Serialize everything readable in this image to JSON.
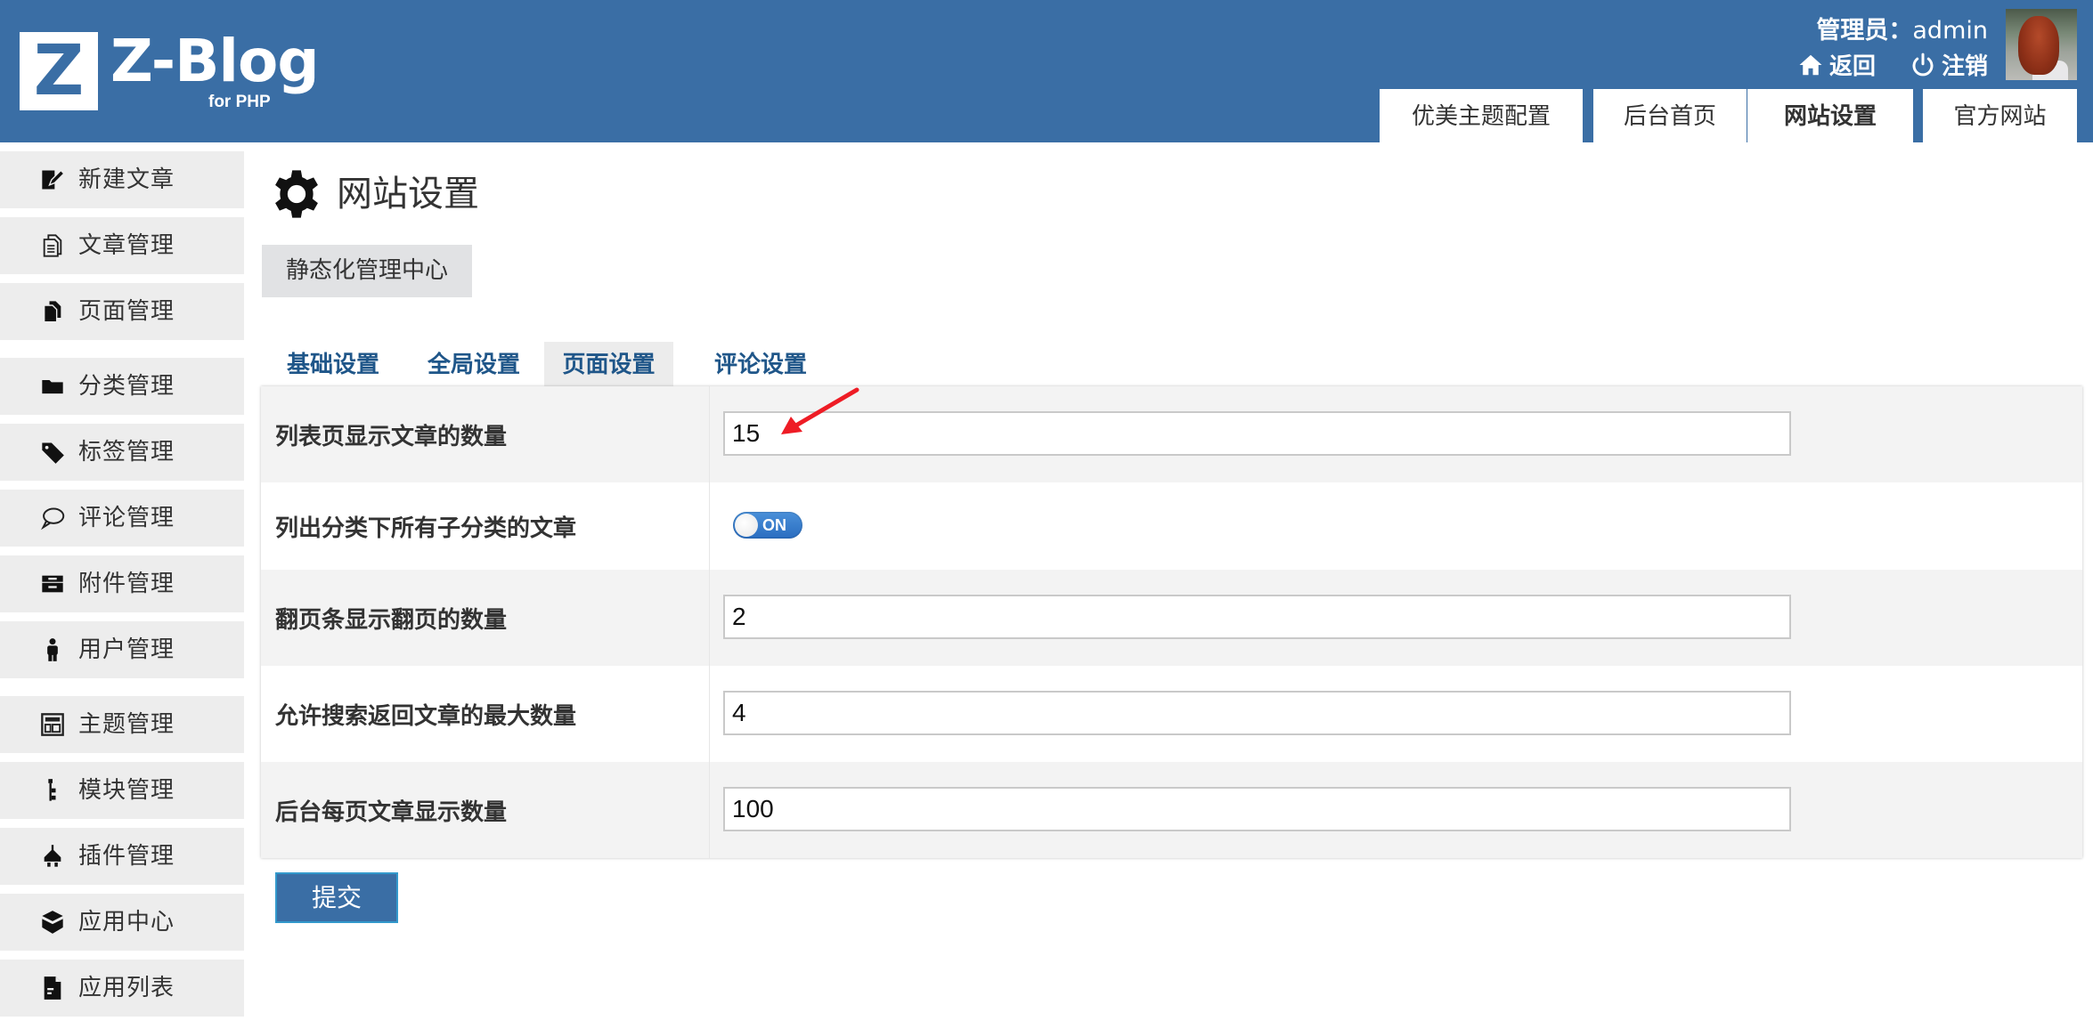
{
  "header": {
    "logo_letter": "Z",
    "logo_text": "Z-Blog",
    "logo_sub": "for PHP",
    "user_prefix": "管理员：",
    "username": "admin",
    "back_label": "返回",
    "logout_label": "注销",
    "bg_color": "#3a6ea5",
    "tabs": [
      {
        "label": "优美主题配置",
        "active": false
      },
      {
        "label": "后台首页",
        "active": false
      },
      {
        "label": "网站设置",
        "active": true
      },
      {
        "label": "官方网站",
        "active": false
      }
    ]
  },
  "sidebar": {
    "items": [
      {
        "label": "新建文章",
        "icon": "edit-icon"
      },
      {
        "label": "文章管理",
        "icon": "documents-icon"
      },
      {
        "label": "页面管理",
        "icon": "page-icon"
      },
      {
        "label": "分类管理",
        "icon": "folder-icon"
      },
      {
        "label": "标签管理",
        "icon": "tag-icon"
      },
      {
        "label": "评论管理",
        "icon": "comment-icon"
      },
      {
        "label": "附件管理",
        "icon": "archive-icon"
      },
      {
        "label": "用户管理",
        "icon": "user-icon"
      },
      {
        "label": "主题管理",
        "icon": "layout-icon"
      },
      {
        "label": "模块管理",
        "icon": "tree-icon"
      },
      {
        "label": "插件管理",
        "icon": "plug-icon"
      },
      {
        "label": "应用中心",
        "icon": "box-icon"
      },
      {
        "label": "应用列表",
        "icon": "file-list-icon"
      }
    ]
  },
  "main": {
    "title": "网站设置",
    "static_button": "静态化管理中心",
    "tabs": [
      {
        "label": "基础设置",
        "active": false
      },
      {
        "label": "全局设置",
        "active": false
      },
      {
        "label": "页面设置",
        "active": true
      },
      {
        "label": "评论设置",
        "active": false
      }
    ],
    "settings": [
      {
        "label": "列表页显示文章的数量",
        "type": "text",
        "value": "15"
      },
      {
        "label": "列出分类下所有子分类的文章",
        "type": "toggle",
        "value": "ON",
        "on": true
      },
      {
        "label": "翻页条显示翻页的数量",
        "type": "text",
        "value": "2"
      },
      {
        "label": "允许搜索返回文章的最大数量",
        "type": "text",
        "value": "4"
      },
      {
        "label": "后台每页文章显示数量",
        "type": "text",
        "value": "100"
      }
    ],
    "submit_label": "提交",
    "accent_color": "#3a6ea5",
    "annotation_color": "#ee1c25"
  }
}
